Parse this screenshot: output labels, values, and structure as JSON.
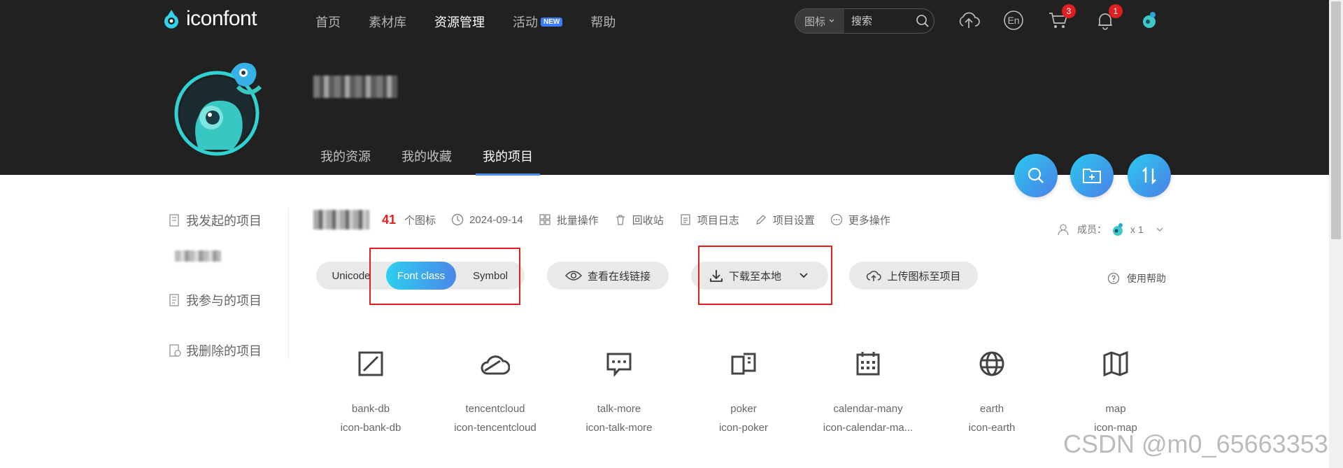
{
  "header": {
    "logo_text": "iconfont",
    "nav": [
      {
        "label": "首页"
      },
      {
        "label": "素材库"
      },
      {
        "label": "资源管理",
        "active": true
      },
      {
        "label": "活动",
        "badge": "NEW"
      },
      {
        "label": "帮助"
      }
    ],
    "search": {
      "type_label": "图标",
      "placeholder": "搜索"
    },
    "language_label": "En",
    "cart_count": "3",
    "notification_count": "1"
  },
  "profile": {
    "subtabs": [
      {
        "label": "我的资源"
      },
      {
        "label": "我的收藏"
      },
      {
        "label": "我的项目",
        "active": true
      }
    ]
  },
  "sidebar": {
    "items": [
      {
        "label": "我发起的项目"
      },
      {
        "label": "我参与的项目"
      },
      {
        "label": "我删除的项目"
      }
    ]
  },
  "project": {
    "icon_count": "41",
    "icon_count_label": "个图标",
    "date": "2024-09-14",
    "actions": [
      {
        "label": "批量操作",
        "icon": "batch-icon"
      },
      {
        "label": "回收站",
        "icon": "trash-icon"
      },
      {
        "label": "项目日志",
        "icon": "log-icon"
      },
      {
        "label": "项目设置",
        "icon": "settings-icon"
      },
      {
        "label": "更多操作",
        "icon": "more-icon"
      }
    ],
    "members_label": "成员：",
    "members_count": "x 1"
  },
  "toolbar": {
    "modes": [
      {
        "label": "Unicode"
      },
      {
        "label": "Font class",
        "active": true
      },
      {
        "label": "Symbol"
      }
    ],
    "view_link_label": "查看在线链接",
    "download_label": "下载至本地",
    "upload_label": "上传图标至项目",
    "help_label": "使用帮助"
  },
  "icons": [
    {
      "name": "bank-db",
      "class": "icon-bank-db",
      "glyph": "bank-db-icon"
    },
    {
      "name": "tencentcloud",
      "class": "icon-tencentcloud",
      "glyph": "tencentcloud-icon"
    },
    {
      "name": "talk-more",
      "class": "icon-talk-more",
      "glyph": "talk-more-icon"
    },
    {
      "name": "poker",
      "class": "icon-poker",
      "glyph": "poker-icon"
    },
    {
      "name": "calendar-many",
      "class": "icon-calendar-ma...",
      "glyph": "calendar-many-icon"
    },
    {
      "name": "earth",
      "class": "icon-earth",
      "glyph": "earth-icon"
    },
    {
      "name": "map",
      "class": "icon-map",
      "glyph": "map-icon"
    }
  ],
  "watermark": "CSDN @m0_65663353",
  "colors": {
    "header_bg": "#212121",
    "accent_gradient_start": "#2dcff0",
    "accent_gradient_end": "#4b87e8",
    "highlight_box": "#e02020",
    "count_red": "#e42020"
  }
}
